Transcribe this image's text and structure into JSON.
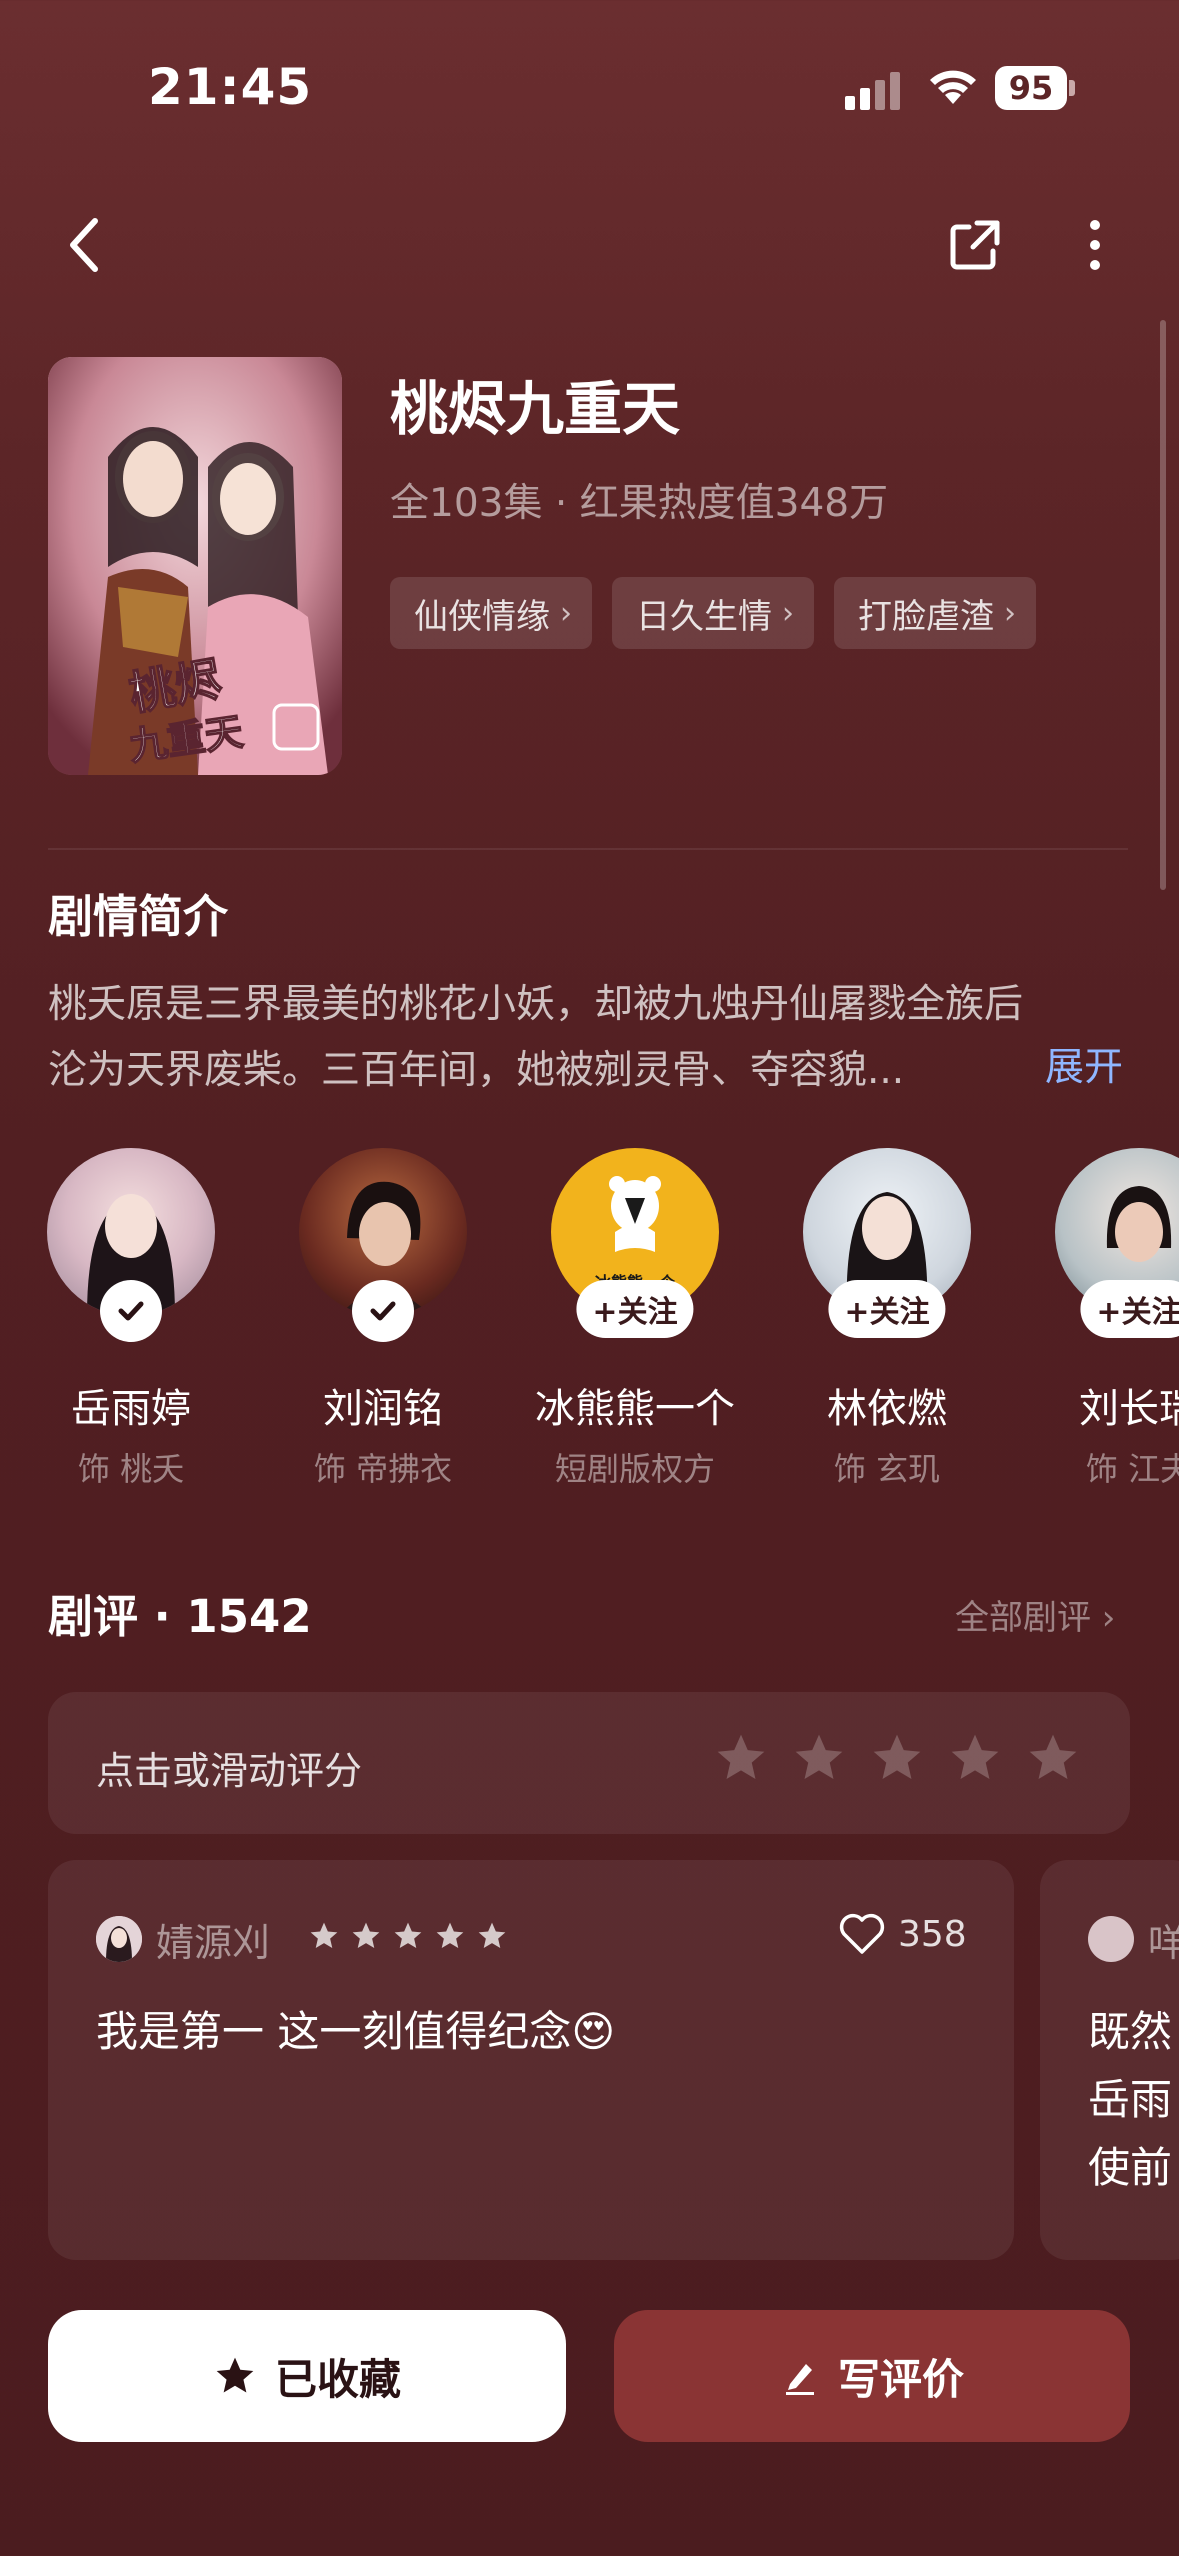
{
  "status_bar": {
    "time": "21:45",
    "battery": "95"
  },
  "drama": {
    "title": "桃烬九重天",
    "meta": "全103集 · 红果热度值348万",
    "tags": [
      "仙侠情缘",
      "日久生情",
      "打脸虐渣"
    ],
    "poster_text": "桃烬九重天"
  },
  "synopsis": {
    "heading": "剧情简介",
    "line1": "桃夭原是三界最美的桃花小妖，却被九烛丹仙屠戮全族后",
    "line2": "沦为天界废柴。三百年间，她被剜灵骨、夺容貌...",
    "expand_label": "展开"
  },
  "cast": [
    {
      "name": "岳雨婷",
      "role": "饰 桃夭",
      "status": "followed"
    },
    {
      "name": "刘润铭",
      "role": "饰 帝拂衣",
      "status": "followed"
    },
    {
      "name": "冰熊熊一个",
      "role": "短剧版权方",
      "status": "follow",
      "logo_text": "冰熊熊一个"
    },
    {
      "name": "林依燃",
      "role": "饰 玄玑",
      "status": "follow"
    },
    {
      "name": "刘长瑞",
      "role": "饰 江夫",
      "status": "follow"
    }
  ],
  "follow_label": "+关注",
  "reviews": {
    "heading": "剧评 · 1542",
    "all_label": "全部剧评 ›",
    "rate_prompt": "点击或滑动评分",
    "items": [
      {
        "user": "婧源刈",
        "rating": 5,
        "likes": "358",
        "text": "我是第一 这一刻值得纪念😍"
      },
      {
        "user": "咩",
        "lines": [
          "既然",
          "岳雨",
          "使前"
        ]
      }
    ]
  },
  "actions": {
    "favorite_label": "已收藏",
    "write_review_label": "写评价"
  },
  "colors": {
    "accent_blue": "#8fb6ff",
    "review_button": "#8a3434",
    "background": "#5c2527"
  }
}
